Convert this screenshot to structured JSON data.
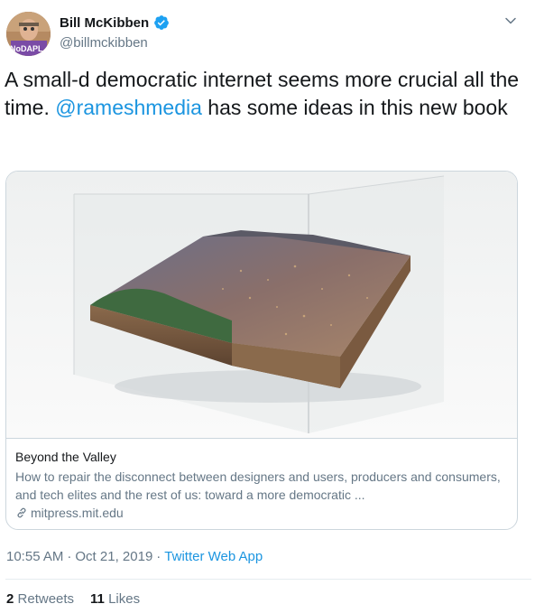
{
  "header": {
    "display_name": "Bill McKibben",
    "handle": "@billmckibben",
    "avatar_badge": "NoDAPL",
    "verified": true
  },
  "tweet": {
    "text_part1": "A  small-d democratic internet seems more crucial all the time. ",
    "mention": "@rameshmedia",
    "text_part2": " has some ideas in this new book"
  },
  "card": {
    "title": "Beyond the Valley",
    "description": "How to repair the disconnect between designers and users, producers and consumers, and tech elites and the rest of us: toward a more democratic ...",
    "domain": "mitpress.mit.edu"
  },
  "meta": {
    "time": "10:55 AM",
    "separator1": "·",
    "date": "Oct 21, 2019",
    "separator2": "·",
    "source": "Twitter Web App"
  },
  "stats": {
    "retweets_count": "2",
    "retweets_label": "Retweets",
    "likes_count": "11",
    "likes_label": "Likes"
  },
  "colors": {
    "link_blue": "#1b95e0",
    "secondary_text": "#657786",
    "verified_blue": "#1da1f2"
  },
  "icons": {
    "verified": "verified-badge-icon",
    "caret": "chevron-down-icon",
    "link": "link-icon"
  }
}
